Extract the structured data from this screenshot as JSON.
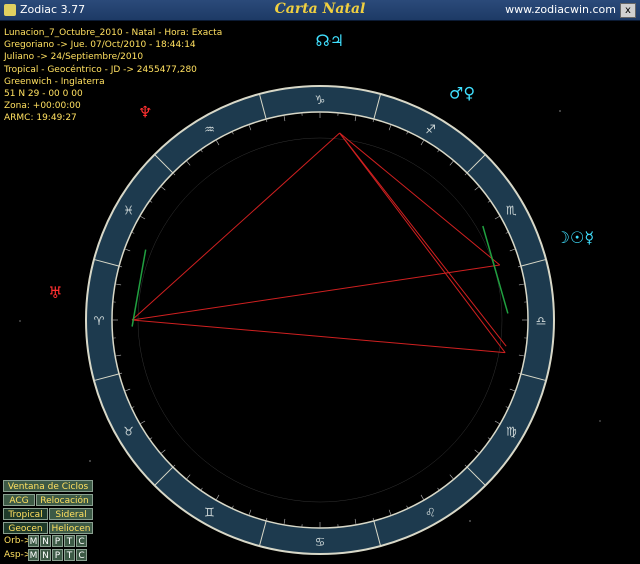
{
  "window": {
    "app_version": "Zodiac 3.77",
    "title": "Carta Natal",
    "website": "www.zodiacwin.com",
    "close_label": "x"
  },
  "info_lines": [
    "Lunacion_7_Octubre_2010 - Natal - Hora: Exacta",
    "Gregoriano -> Jue. 07/Oct/2010 - 18:44:14",
    "Juliano -> 24/Septiembre/2010",
    "Tropical - Geocéntrico - JD -> 2455477,280",
    "Greenwich - Inglaterra",
    "51 N 29 - 00 0 00",
    "Zona: +00:00:00",
    "ARMC: 19:49:27"
  ],
  "zodiac_signs": [
    {
      "name": "Cancer",
      "glyph": "♋"
    },
    {
      "name": "Gemini",
      "glyph": "♊"
    },
    {
      "name": "Taurus",
      "glyph": "♉"
    },
    {
      "name": "Aries",
      "glyph": "♈"
    },
    {
      "name": "Pisces",
      "glyph": "♓"
    },
    {
      "name": "Aquarius",
      "glyph": "♒"
    },
    {
      "name": "Capricorn",
      "glyph": "♑"
    },
    {
      "name": "Sagittarius",
      "glyph": "♐"
    },
    {
      "name": "Scorpio",
      "glyph": "♏"
    },
    {
      "name": "Libra",
      "glyph": "♎"
    },
    {
      "name": "Virgo",
      "glyph": "♍"
    },
    {
      "name": "Leo",
      "glyph": "♌"
    }
  ],
  "planets": [
    {
      "name": "North Node + Jupiter",
      "glyph": "☊♃",
      "color": "#40e0ff"
    },
    {
      "name": "Mars + Venus",
      "glyph": "♂♀",
      "color": "#40e0ff"
    },
    {
      "name": "Moon + Sun + Mercury",
      "glyph": "☽☉☿",
      "color": "#40e0ff"
    },
    {
      "name": "Neptune",
      "glyph": "♆",
      "color": "#ff3030"
    },
    {
      "name": "Uranus",
      "glyph": "♅",
      "color": "#ff3030"
    }
  ],
  "colors": {
    "ring_fill": "#1d3a4e",
    "ring_border": "#d8d8c8",
    "aspect_red": "#d02020",
    "aspect_green": "#20a040",
    "info_text": "#ffe060"
  },
  "panel": {
    "ventana_ciclos": "Ventana de Ciclos",
    "acg": "ACG",
    "relocacion": "Relocación",
    "tropical": "Tropical",
    "sideral": "Sideral",
    "geocen": "Geocen",
    "heliocen": "Heliocen",
    "orb_label": "Orb->",
    "asp_label": "Asp->",
    "toggles": [
      "M",
      "N",
      "P",
      "T",
      "C"
    ]
  }
}
